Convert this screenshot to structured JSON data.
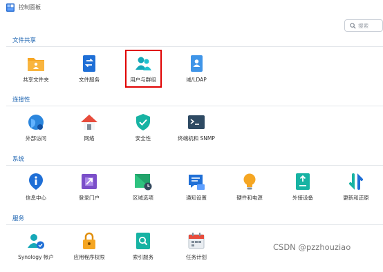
{
  "window": {
    "title": "控制面板"
  },
  "search": {
    "placeholder": "搜索"
  },
  "sections": [
    {
      "title": "文件共享",
      "items": [
        {
          "label": "共享文件夹",
          "icon": "shared-folder-icon"
        },
        {
          "label": "文件服务",
          "icon": "file-services-icon"
        },
        {
          "label": "用户与群组",
          "icon": "user-group-icon",
          "highlighted": true
        },
        {
          "label": "域/LDAP",
          "icon": "domain-ldap-icon"
        }
      ]
    },
    {
      "title": "连接性",
      "items": [
        {
          "label": "外部访问",
          "icon": "external-access-icon"
        },
        {
          "label": "网络",
          "icon": "network-icon"
        },
        {
          "label": "安全性",
          "icon": "security-shield-icon"
        },
        {
          "label": "终端机和 SNMP",
          "icon": "terminal-icon"
        }
      ]
    },
    {
      "title": "系统",
      "items": [
        {
          "label": "信息中心",
          "icon": "info-center-icon"
        },
        {
          "label": "登录门户",
          "icon": "login-portal-icon"
        },
        {
          "label": "区域选项",
          "icon": "regional-options-icon"
        },
        {
          "label": "通知设置",
          "icon": "notification-icon"
        },
        {
          "label": "硬件和电源",
          "icon": "hardware-power-icon"
        },
        {
          "label": "外接设备",
          "icon": "external-devices-icon"
        },
        {
          "label": "更新和还原",
          "icon": "update-restore-icon"
        }
      ]
    },
    {
      "title": "服务",
      "items": [
        {
          "label": "Synology 帐户",
          "icon": "synology-account-icon"
        },
        {
          "label": "应用程序权限",
          "icon": "app-privileges-icon"
        },
        {
          "label": "索引服务",
          "icon": "indexing-service-icon"
        },
        {
          "label": "任务计划",
          "icon": "task-scheduler-icon"
        }
      ]
    }
  ],
  "watermark": "CSDN @pzzhouziao",
  "colors": {
    "section_title": "#1a62b0",
    "highlight_border": "#e00000"
  }
}
